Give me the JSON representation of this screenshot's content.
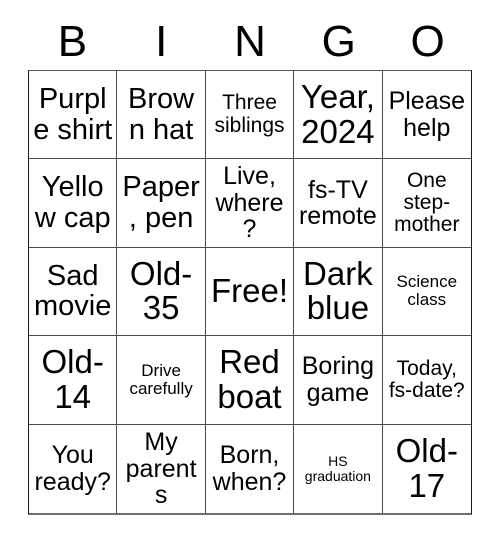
{
  "card": {
    "header_letters": [
      "B",
      "I",
      "N",
      "G",
      "O"
    ],
    "rows": [
      [
        {
          "text": "Purple shirt",
          "size": "lg"
        },
        {
          "text": "Brown hat",
          "size": "lg"
        },
        {
          "text": "Three siblings",
          "size": "sm"
        },
        {
          "text": "Year, 2024",
          "size": "xl"
        },
        {
          "text": "Please help",
          "size": "md"
        }
      ],
      [
        {
          "text": "Yellow cap",
          "size": "lg"
        },
        {
          "text": "Paper, pen",
          "size": "lg"
        },
        {
          "text": "Live, where?",
          "size": "md"
        },
        {
          "text": "fs-TV remote",
          "size": "md"
        },
        {
          "text": "One step-mother",
          "size": "sm"
        }
      ],
      [
        {
          "text": "Sad movie",
          "size": "lg"
        },
        {
          "text": "Old-35",
          "size": "xl"
        },
        {
          "text": "Free!",
          "size": "xl"
        },
        {
          "text": "Dark blue",
          "size": "xl"
        },
        {
          "text": "Science class",
          "size": "xs"
        }
      ],
      [
        {
          "text": "Old-14",
          "size": "xl"
        },
        {
          "text": "Drive carefully",
          "size": "xs"
        },
        {
          "text": "Red boat",
          "size": "xl"
        },
        {
          "text": "Boring game",
          "size": "md"
        },
        {
          "text": "Today, fs-date?",
          "size": "sm"
        }
      ],
      [
        {
          "text": "You ready?",
          "size": "md"
        },
        {
          "text": "My parents",
          "size": "md"
        },
        {
          "text": "Born, when?",
          "size": "md"
        },
        {
          "text": "HS graduation",
          "size": "xxs"
        },
        {
          "text": "Old-17",
          "size": "xl"
        }
      ]
    ]
  },
  "colors": {
    "background": "#ffffff",
    "text": "#000000",
    "grid_line": "#4d4d4d",
    "grid_border": "#1a1a1a"
  }
}
